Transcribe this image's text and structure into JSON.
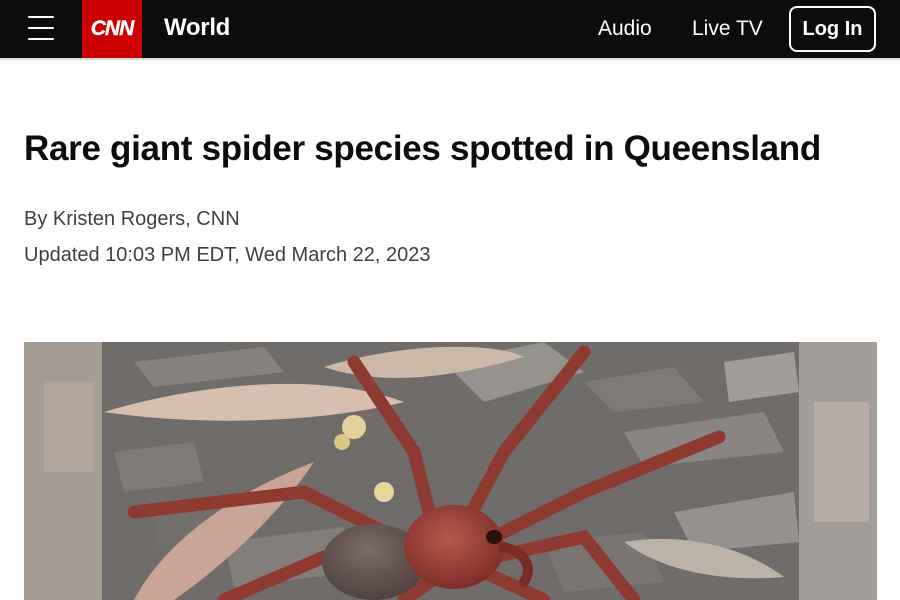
{
  "header": {
    "logo_text": "CNN",
    "section": "World",
    "nav": [
      {
        "label": "Audio"
      },
      {
        "label": "Live TV"
      }
    ],
    "login_label": "Log In",
    "brand_color": "#cc0000"
  },
  "article": {
    "headline": "Rare giant spider species spotted in Queensland",
    "byline_prefix": "By ",
    "author": "Kristen Rogers",
    "author_suffix": ", CNN",
    "updated": "Updated 10:03 PM EDT, Wed March 22, 2023"
  },
  "photo": {
    "subject": "giant-spider-photo"
  }
}
